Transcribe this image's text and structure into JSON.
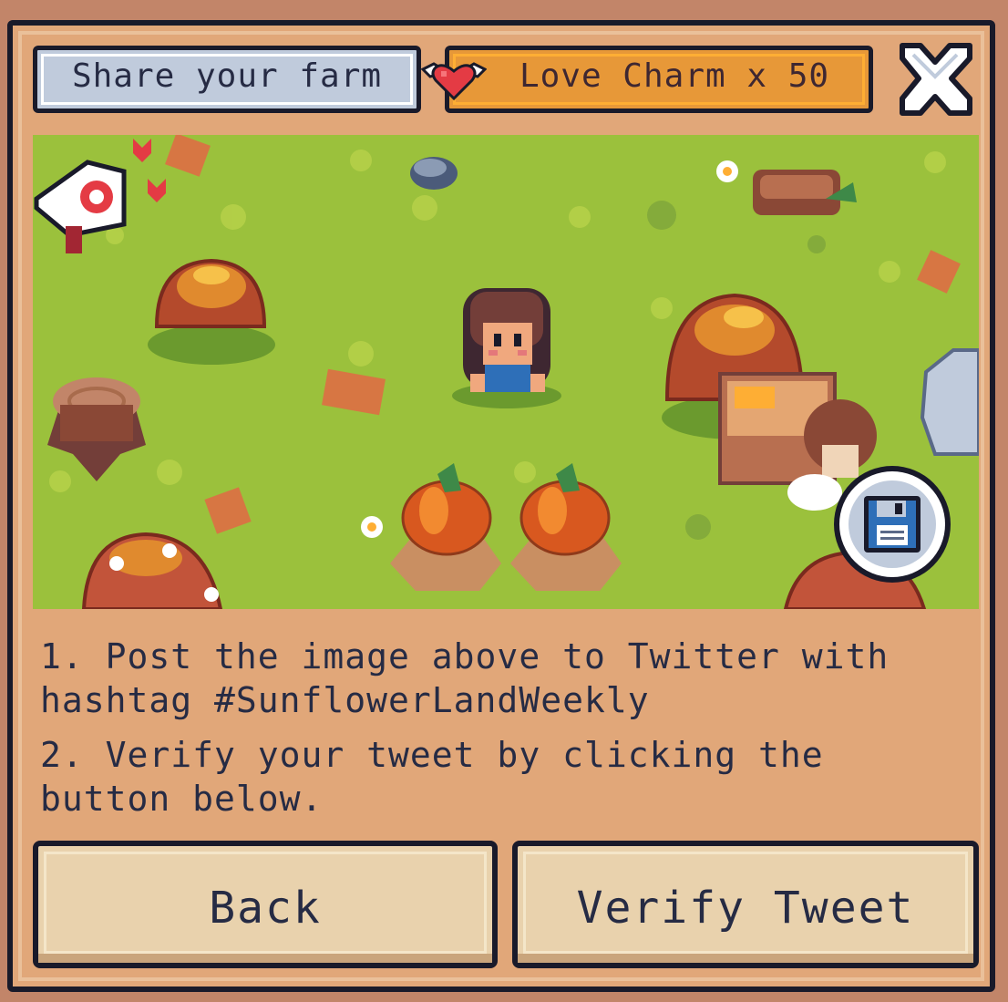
{
  "header": {
    "title": "Share your farm",
    "reward": "Love Charm x 50",
    "reward_icon": "winged-heart-icon",
    "close_icon": "close-icon"
  },
  "instructions": {
    "step1_line1": "1. Post the image above to Twitter with",
    "step1_line2": "hashtag #SunflowerLandWeekly",
    "step2_line1": "2. Verify your tweet by clicking the",
    "step2_line2": "button below."
  },
  "buttons": {
    "back": "Back",
    "verify": "Verify Tweet"
  },
  "save_icon": "floppy-disk-icon",
  "colors": {
    "panel": "#e1a779",
    "border": "#191a2a",
    "grass": "#9bc13c",
    "reward_bg": "#e79838",
    "title_bg": "#c0cbdc",
    "button_bg": "#e9d2ad"
  }
}
